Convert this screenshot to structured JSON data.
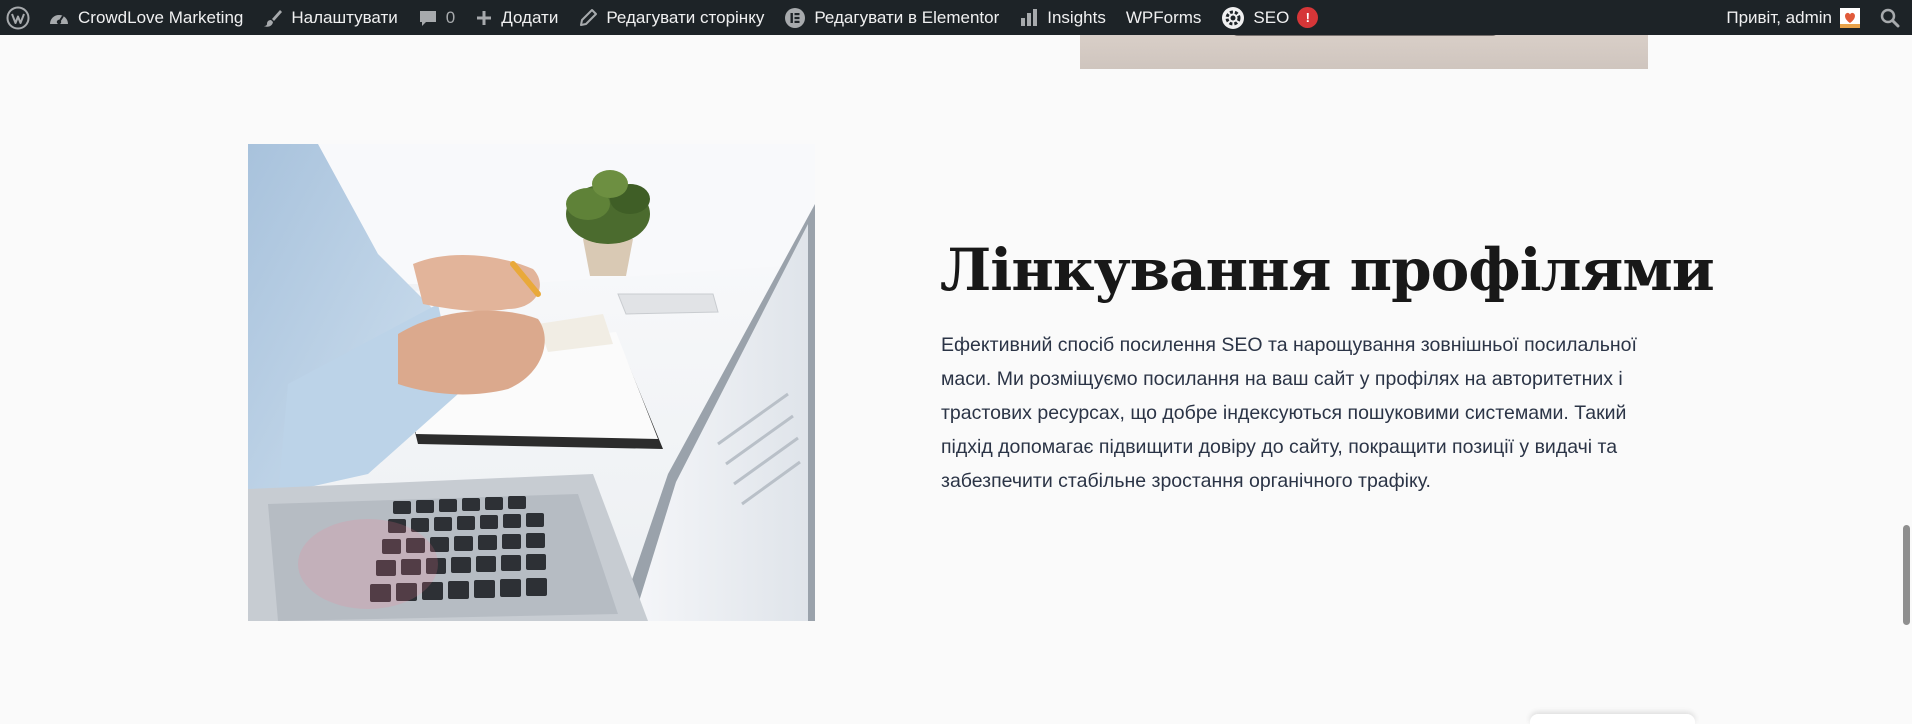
{
  "adminbar": {
    "wp_logo_icon": "wordpress-icon",
    "site_name": "CrowdLove Marketing",
    "customize_label": "Налаштувати",
    "comments_count": "0",
    "new_label": "Додати",
    "edit_page_label": "Редагувати сторінку",
    "elementor_label": "Редагувати в Elementor",
    "insights_label": "Insights",
    "wpforms_label": "WPForms",
    "seo_label": "SEO",
    "seo_badge": "!",
    "greeting": "Привіт, admin",
    "colors": {
      "background": "#1d2327",
      "text": "#f0f0f1",
      "badge": "#d63638"
    }
  },
  "section": {
    "title": "Лінкування профілями",
    "paragraph": "Ефективний спосіб посилення SEO та нарощування зовнішньої посилальної маси. Ми розміщуємо посилання на ваш сайт у профілях на авторитетних і трастових ресурсах, що добре індексуються пошуковими системами. Такий підхід допомагає підвищити довіру до сайту, покращити позиції у видачі та забезпечити стабільне зростання органічного трафіку."
  },
  "colors": {
    "page_background": "#fafafa",
    "heading": "#181818",
    "body_text": "#2b3446"
  }
}
